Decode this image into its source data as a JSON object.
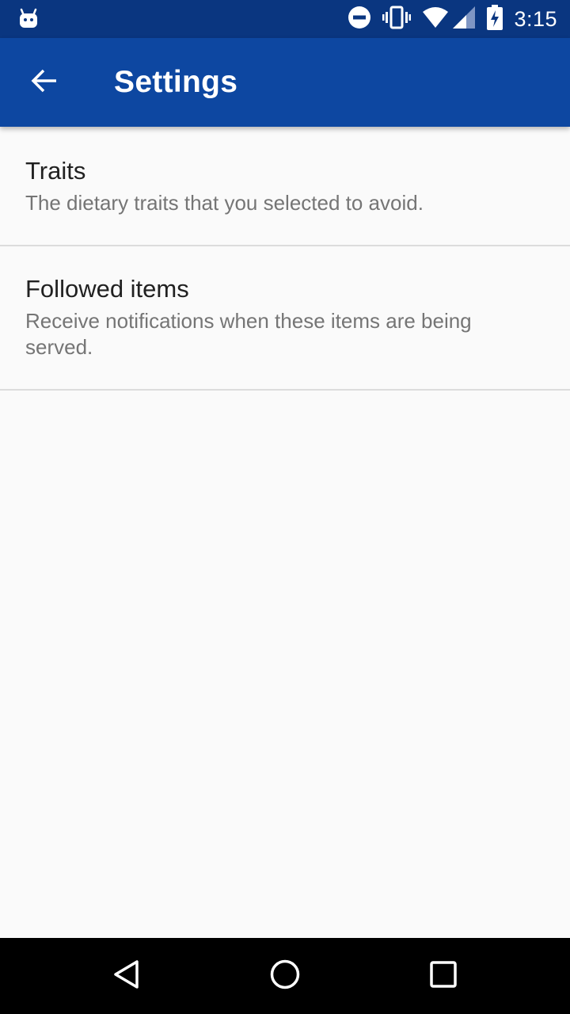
{
  "status_bar": {
    "time": "3:15",
    "icons": [
      "android-notification-icon",
      "do-not-disturb-icon",
      "vibrate-icon",
      "wifi-icon",
      "cell-signal-icon",
      "battery-charging-icon"
    ]
  },
  "app_bar": {
    "title": "Settings",
    "back_icon": "arrow-back-icon"
  },
  "preferences": [
    {
      "title": "Traits",
      "summary": "The dietary traits that you selected to avoid."
    },
    {
      "title": "Followed items",
      "summary": "Receive notifications when these items are being served."
    }
  ],
  "nav_bar": {
    "buttons": [
      "back-triangle-icon",
      "home-circle-icon",
      "recents-square-icon"
    ]
  },
  "colors": {
    "status_bar": "#0a3680",
    "app_bar": "#0d47a1",
    "background": "#fafafa",
    "divider": "#dcdcdc",
    "title_text": "#212121",
    "summary_text": "#757575"
  }
}
